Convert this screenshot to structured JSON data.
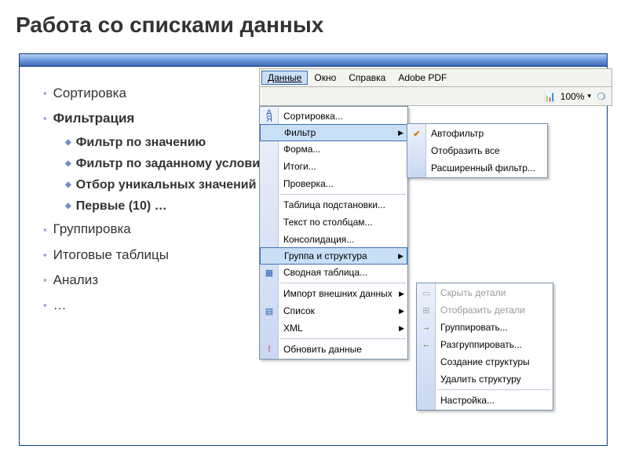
{
  "title": "Работа со списками данных",
  "outline": {
    "i0": "Сортировка",
    "i1": "Фильтрация",
    "sub": {
      "s0": "Фильтр по значению",
      "s1": "Фильтр по заданному условию",
      "s2": "Отбор уникальных значений",
      "s3": "Первые (10) …"
    },
    "i2": "Группировка",
    "i3": "Итоговые таблицы",
    "i4": "Анализ",
    "i5": "…"
  },
  "menubar": {
    "data": "Данные",
    "window": "Окно",
    "help": "Справка",
    "adobe": "Adobe PDF"
  },
  "toolbar": {
    "zoom": "100%"
  },
  "menu": {
    "sort": "Сортировка...",
    "filter": "Фильтр",
    "form": "Форма...",
    "totals": "Итоги...",
    "validation": "Проверка...",
    "lookup": "Таблица подстановки...",
    "texttocol": "Текст по столбцам...",
    "consol": "Консолидация...",
    "group": "Группа и структура",
    "pivot": "Сводная таблица...",
    "import": "Импорт внешних данных",
    "list": "Список",
    "xml": "XML",
    "refresh": "Обновить данные"
  },
  "submenu_filter": {
    "auto": "Автофильтр",
    "showall": "Отобразить все",
    "advanced": "Расширенный фильтр..."
  },
  "submenu_group": {
    "hide": "Скрыть детали",
    "show": "Отобразить детали",
    "group": "Группировать...",
    "ungroup": "Разгруппировать...",
    "create": "Создание структуры",
    "delete": "Удалить структуру",
    "settings": "Настройка..."
  }
}
